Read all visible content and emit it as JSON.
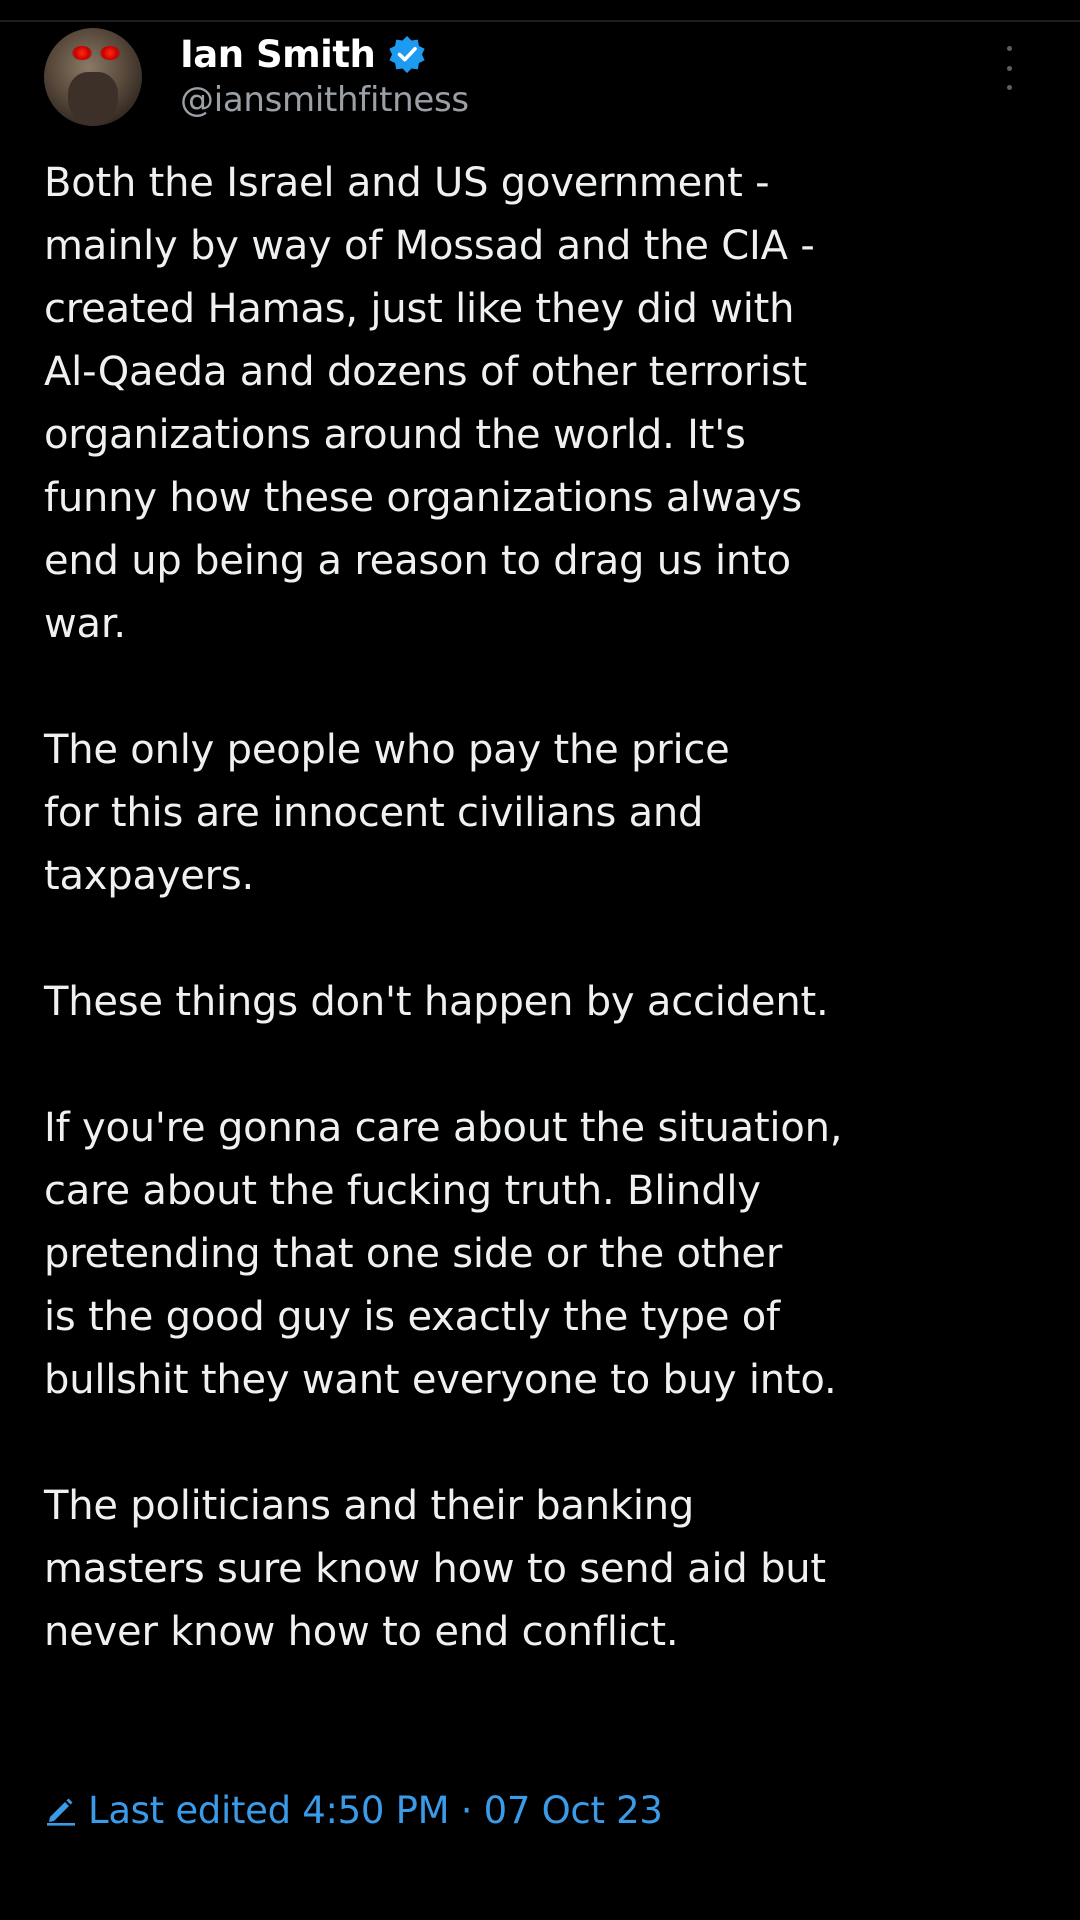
{
  "author": {
    "display_name": "Ian Smith",
    "handle": "@iansmithfitness",
    "verified": true
  },
  "tweet": {
    "paragraphs": [
      "Both the Israel and US government -\nmainly by way of Mossad and the CIA -\ncreated Hamas, just like they did with\nAl-Qaeda and dozens of other terrorist\norganizations around the world. It's\nfunny how these organizations always\nend up being a reason to drag us into\nwar.",
      "The only people who pay the price\nfor this are innocent civilians and\ntaxpayers.",
      "These things don't happen by accident.",
      "If you're gonna care about the situation,\ncare about the fucking truth. Blindly\npretending that one side or the other\nis the good guy is exactly the type of\nbullshit they want everyone to buy into.",
      "The politicians and their banking\nmasters sure know how to send aid but\nnever know how to end conflict."
    ],
    "edited_label": "Last edited 4:50 PM · 07 Oct 23"
  },
  "icons": {
    "verified": "verified-badge-icon",
    "more": "more-options-icon",
    "edited": "pencil-icon"
  },
  "colors": {
    "background": "#000000",
    "text": "#eef0f1",
    "secondary_text": "#9aa0a6",
    "accent": "#3a9be9",
    "verified_badge": "#1d9bf0"
  }
}
